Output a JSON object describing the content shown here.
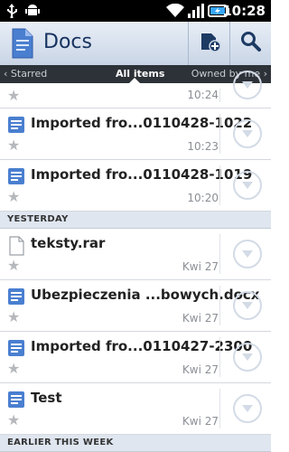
{
  "status_bar": {
    "time": "10:28"
  },
  "app": {
    "title": "Docs"
  },
  "tabs": {
    "left": "‹ Starred",
    "center": "All items",
    "right": "Owned by me ›"
  },
  "rows": [
    {
      "name": "",
      "date": "10:24",
      "icon": "doc-icon"
    },
    {
      "name": "Imported fro...0110428-1022",
      "date": "10:23",
      "icon": "doc-icon"
    },
    {
      "name": "Imported fro...0110428-1019",
      "date": "10:20",
      "icon": "doc-icon"
    },
    {
      "name": "teksty.rar",
      "date": "Kwi 27",
      "icon": "file-icon"
    },
    {
      "name": "Ubezpieczenia ...bowych.docx",
      "date": "Kwi 27",
      "icon": "doc-icon"
    },
    {
      "name": "Imported fro...0110427-2300",
      "date": "Kwi 27",
      "icon": "doc-icon"
    },
    {
      "name": "Test",
      "date": "Kwi 27",
      "icon": "doc-icon"
    }
  ],
  "sections": {
    "yesterday": "YESTERDAY",
    "earlier": "EARLIER THIS WEEK"
  },
  "colors": {
    "accent": "#16325f",
    "doc_icon": "#4a7fd0",
    "tabbar": "#2d3238",
    "section_bg": "#dfe6f0"
  }
}
